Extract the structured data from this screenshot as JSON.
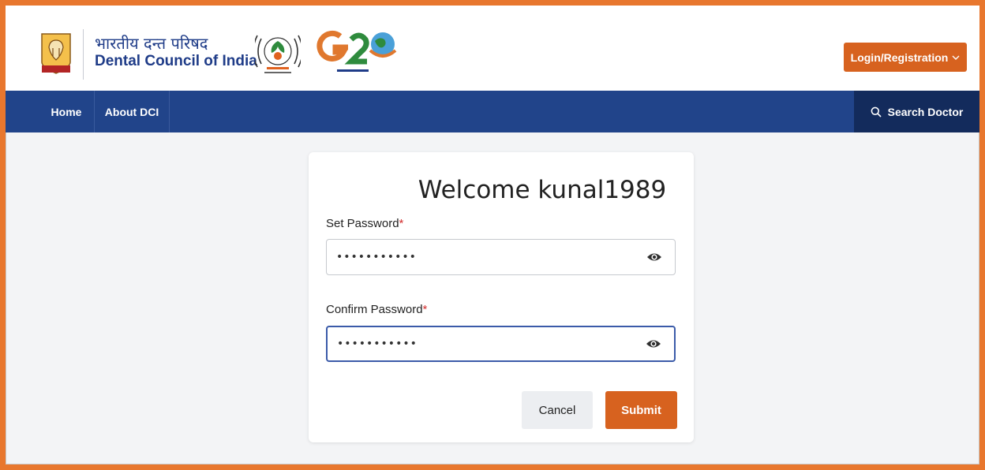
{
  "header": {
    "brand_hindi": "भारतीय दन्त परिषद",
    "brand_english": "Dental Council of India",
    "login_label": "Login/Registration"
  },
  "nav": {
    "items": [
      {
        "label": "Home"
      },
      {
        "label": "About DCI"
      }
    ],
    "search_label": "Search Doctor"
  },
  "form": {
    "title": "Welcome kunal1989",
    "set_password": {
      "label": "Set Password",
      "required_mark": "*",
      "value": "•••••••••••",
      "icon": "eye-icon"
    },
    "confirm_password": {
      "label": "Confirm Password",
      "required_mark": "*",
      "value": "•••••••••••",
      "icon": "eye-icon"
    },
    "cancel_label": "Cancel",
    "submit_label": "Submit"
  },
  "colors": {
    "frame_border": "#e8772e",
    "accent": "#d7621f",
    "navbar": "#21448a",
    "search_bg": "#132b5c",
    "focus_border": "#3b5ba9"
  }
}
